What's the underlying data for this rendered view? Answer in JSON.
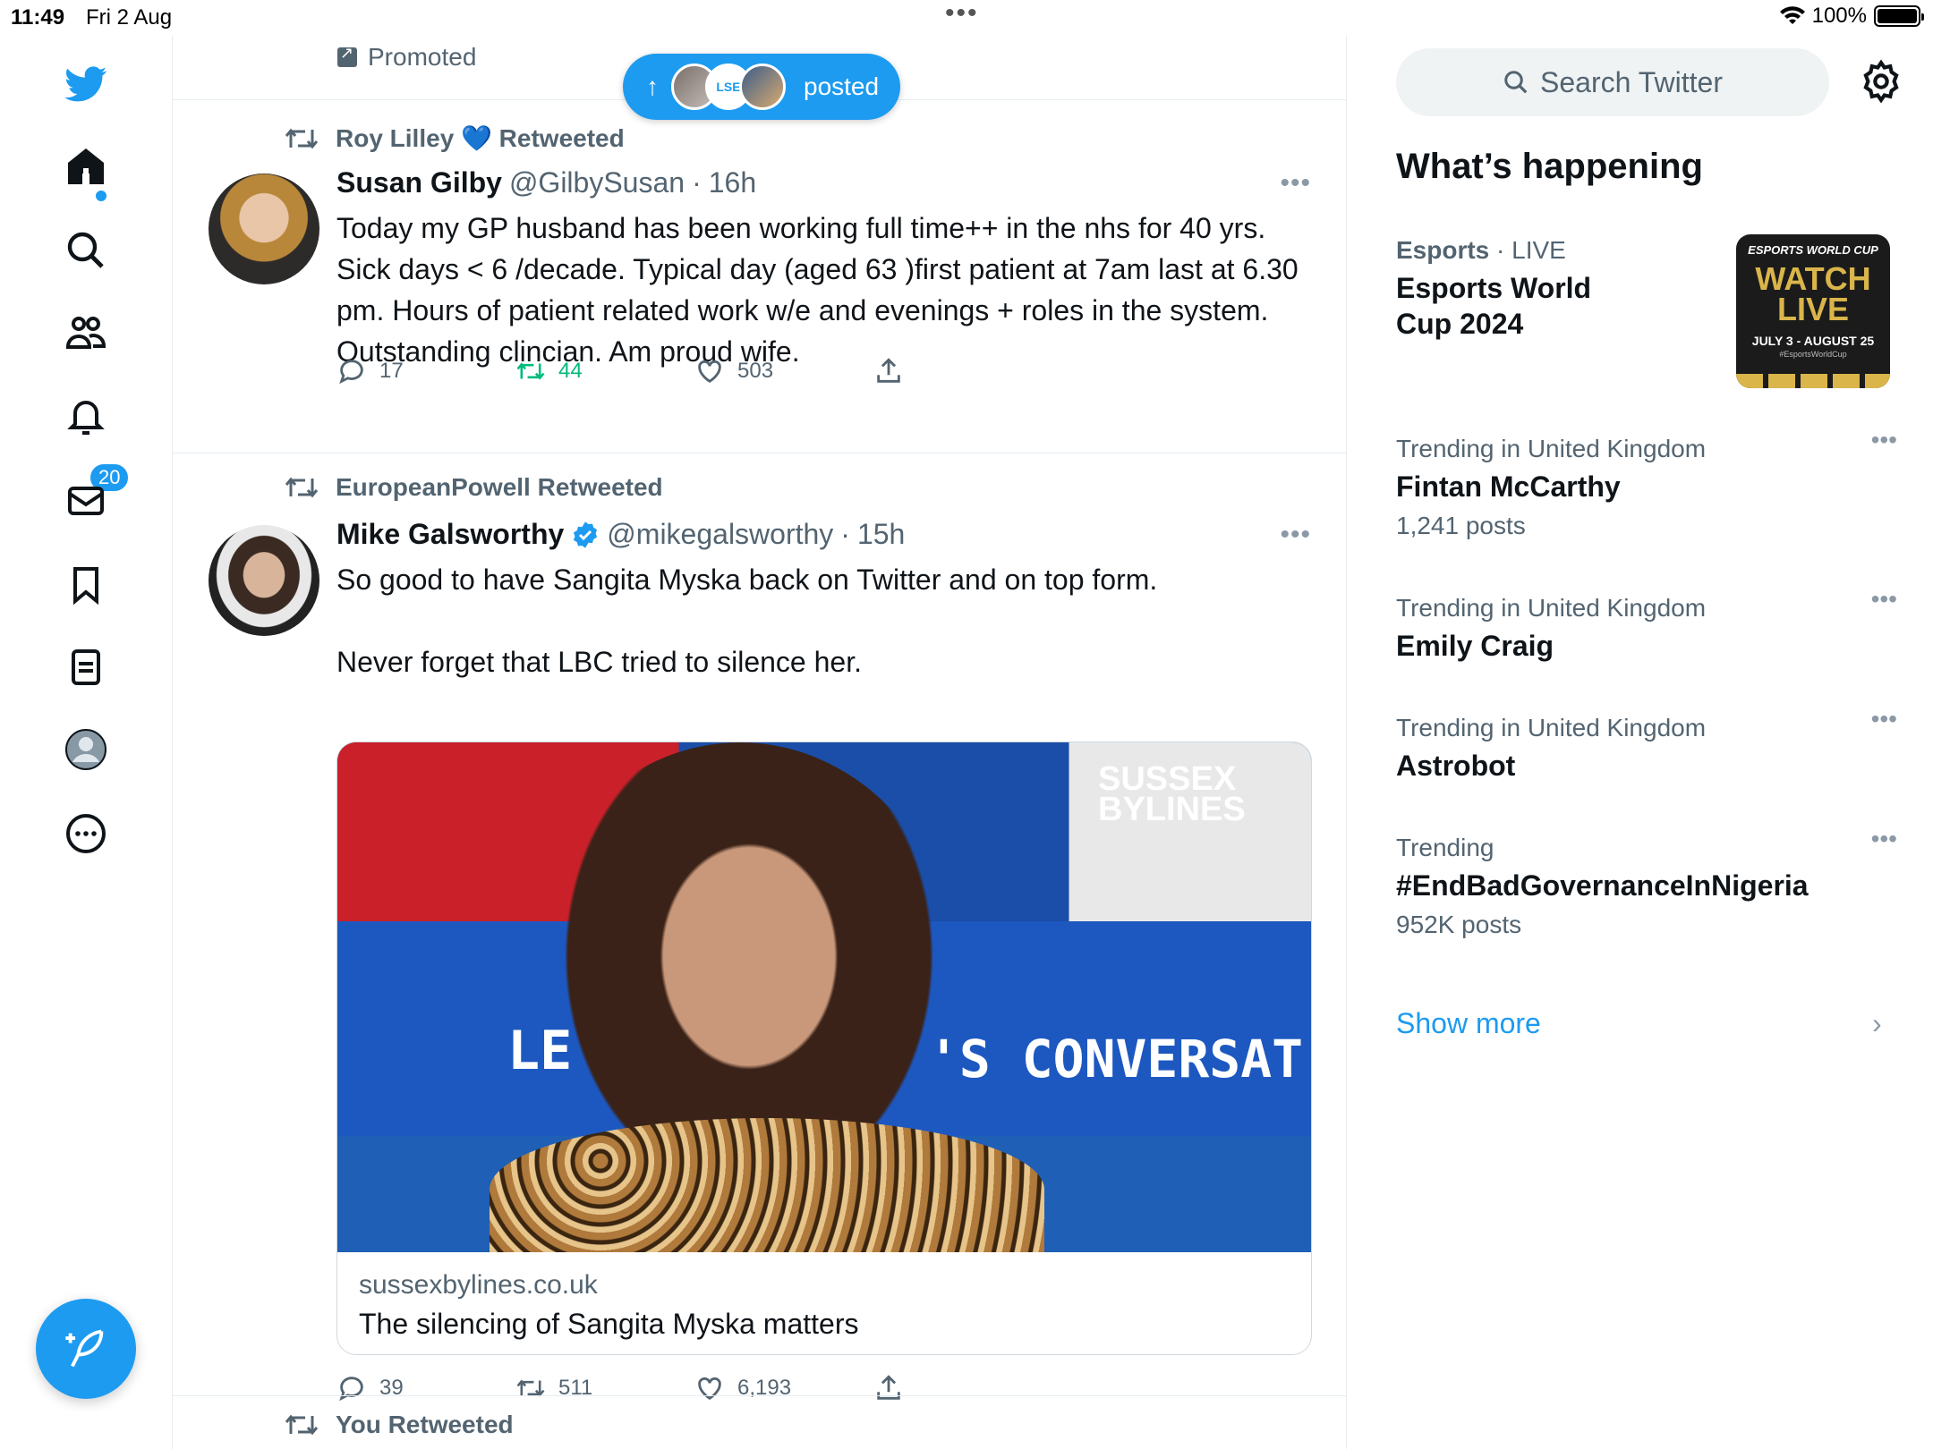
{
  "status": {
    "time": "11:49",
    "date": "Fri 2 Aug",
    "battery": "100%",
    "battery_level": 1.0
  },
  "nav": {
    "notifications_badge": "20"
  },
  "timeline": {
    "promoted_label": "Promoted",
    "posted_pill": {
      "label": "posted",
      "avatar_2_text": "LSE"
    },
    "tweets": [
      {
        "retweeted_by": "Roy Lilley 💙 Retweeted",
        "name": "Susan Gilby",
        "handle": "@GilbySusan",
        "time": "16h",
        "text": "Today my GP husband has been working full time++ in  the nhs for 40 yrs. Sick days < 6 /decade. Typical day (aged 63 )first patient at 7am last at 6.30 pm. Hours of patient related work w/e and evenings + roles in the system. Outstanding clincian.  Am proud wife.",
        "replies": "17",
        "retweets": "44",
        "likes": "503"
      },
      {
        "retweeted_by": "EuropeanPowell Retweeted",
        "name": "Mike Galsworthy",
        "handle": "@mikegalsworthy",
        "time": "15h",
        "text": "So good to have Sangita Myska back on Twitter and on top form.\n\nNever forget that LBC tried to silence her.",
        "card": {
          "domain": "sussexbylines.co.uk",
          "title": "The silencing of Sangita Myska matters",
          "image_overlay_logo": "SUSSEX BYLINES",
          "image_banner_left": "LE",
          "image_banner_right": "'S CONVERSAT"
        },
        "replies": "39",
        "retweets": "511",
        "likes": "6,193"
      },
      {
        "retweeted_by": "You Retweeted"
      }
    ]
  },
  "sidebar": {
    "search_placeholder": "Search Twitter",
    "section_title": "What’s happening",
    "featured": {
      "category": "Esports",
      "status": "LIVE",
      "title": "Esports World Cup 2024",
      "thumb_line1": "ESPORTS WORLD CUP",
      "thumb_line2": "WATCH LIVE",
      "thumb_line3": "JULY 3 - AUGUST 25",
      "thumb_line4": "#EsportsWorldCup"
    },
    "trends": [
      {
        "context": "Trending in United Kingdom",
        "name": "Fintan McCarthy",
        "count": "1,241 posts"
      },
      {
        "context": "Trending in United Kingdom",
        "name": "Emily Craig",
        "count": ""
      },
      {
        "context": "Trending in United Kingdom",
        "name": "Astrobot",
        "count": ""
      },
      {
        "context": "Trending",
        "name": "#EndBadGovernanceInNigeria",
        "count": "952K posts"
      }
    ],
    "show_more": "Show more"
  },
  "colors": {
    "accent": "#1d9bf0",
    "retweet_green": "#00ba7c",
    "secondary_text": "#536471"
  }
}
